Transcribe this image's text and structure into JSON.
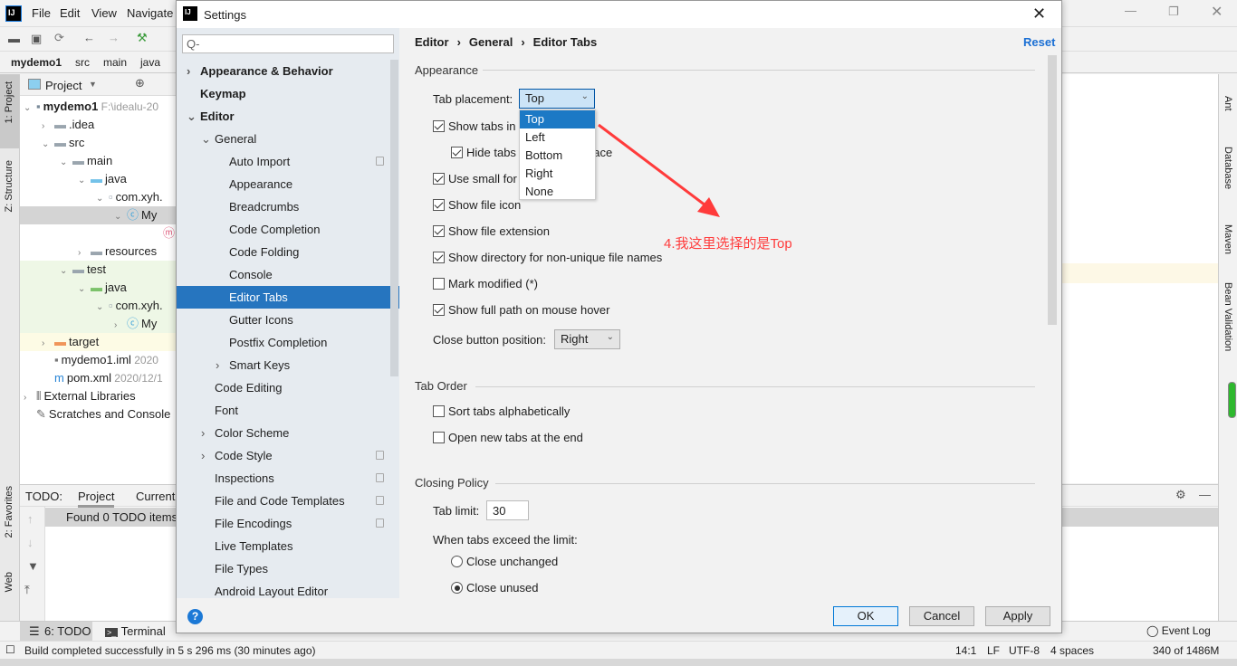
{
  "ide": {
    "menu": [
      "File",
      "Edit",
      "View",
      "Navigate"
    ],
    "breadcrumb": [
      "mydemo1",
      "src",
      "main",
      "java"
    ],
    "left_strip": [
      "1: Project",
      "Z: Structure",
      "2: Favorites",
      "Web"
    ],
    "right_strip": [
      "Ant",
      "Database",
      "Maven",
      "Bean Validation"
    ],
    "project_panel": {
      "title": "Project",
      "tree": [
        {
          "label": "mydemo1",
          "extra": "F:\\idealu-20",
          "bold": true
        },
        {
          "label": ".idea"
        },
        {
          "label": "src"
        },
        {
          "label": "main"
        },
        {
          "label": "java"
        },
        {
          "label": "com.xyh."
        },
        {
          "label": "My"
        },
        {
          "label": ""
        },
        {
          "label": "resources"
        },
        {
          "label": "test"
        },
        {
          "label": "java"
        },
        {
          "label": "com.xyh."
        },
        {
          "label": "My"
        },
        {
          "label": "target"
        },
        {
          "label": "mydemo1.iml",
          "extra": "2020"
        },
        {
          "label": "pom.xml",
          "extra": "2020/12/1"
        },
        {
          "label": "External Libraries"
        },
        {
          "label": "Scratches and Console"
        }
      ]
    },
    "todo": {
      "label": "TODO:",
      "tabs": [
        "Project",
        "Current"
      ],
      "found": "Found 0 TODO items"
    },
    "bottom_tabs": [
      "6: TODO",
      "Terminal"
    ],
    "event_log": "Event Log",
    "status": {
      "message": "Build completed successfully in 5 s 296 ms (30 minutes ago)",
      "position": "14:1",
      "line_sep": "LF",
      "encoding": "UTF-8",
      "indent": "4 spaces",
      "memory": "340 of 1486M"
    }
  },
  "dialog": {
    "title": "Settings",
    "search_placeholder": "Q-",
    "breadcrumb": [
      "Editor",
      "General",
      "Editor Tabs"
    ],
    "reset": "Reset",
    "nav": [
      {
        "label": "Appearance & Behavior",
        "level": 0,
        "bold": true,
        "chev": ">"
      },
      {
        "label": "Keymap",
        "level": 0,
        "bold": true
      },
      {
        "label": "Editor",
        "level": 0,
        "bold": true,
        "chev": "v"
      },
      {
        "label": "General",
        "level": 1,
        "chev": "v"
      },
      {
        "label": "Auto Import",
        "level": 2,
        "copy": true
      },
      {
        "label": "Appearance",
        "level": 2
      },
      {
        "label": "Breadcrumbs",
        "level": 2
      },
      {
        "label": "Code Completion",
        "level": 2
      },
      {
        "label": "Code Folding",
        "level": 2
      },
      {
        "label": "Console",
        "level": 2
      },
      {
        "label": "Editor Tabs",
        "level": 2,
        "selected": true
      },
      {
        "label": "Gutter Icons",
        "level": 2
      },
      {
        "label": "Postfix Completion",
        "level": 2
      },
      {
        "label": "Smart Keys",
        "level": 2,
        "chev": ">"
      },
      {
        "label": "Code Editing",
        "level": 1
      },
      {
        "label": "Font",
        "level": 1
      },
      {
        "label": "Color Scheme",
        "level": 1,
        "chev": ">"
      },
      {
        "label": "Code Style",
        "level": 1,
        "chev": ">",
        "copy": true
      },
      {
        "label": "Inspections",
        "level": 1,
        "copy": true
      },
      {
        "label": "File and Code Templates",
        "level": 1,
        "copy": true
      },
      {
        "label": "File Encodings",
        "level": 1,
        "copy": true
      },
      {
        "label": "Live Templates",
        "level": 1
      },
      {
        "label": "File Types",
        "level": 1
      },
      {
        "label": "Android Layout Editor",
        "level": 1
      }
    ],
    "appearance": {
      "title": "Appearance",
      "tab_placement_label": "Tab placement:",
      "tab_placement_value": "Top",
      "tab_placement_options": [
        "Top",
        "Left",
        "Bottom",
        "Right",
        "None"
      ],
      "options": [
        {
          "label": "Show tabs in",
          "checked": true,
          "indent": false
        },
        {
          "label": "Hide tabs",
          "suffix": "pace",
          "checked": true,
          "indent": true
        },
        {
          "label": "Use small for",
          "checked": true,
          "indent": false
        },
        {
          "label": "Show file icon",
          "checked": true,
          "indent": false
        },
        {
          "label": "Show file extension",
          "checked": true,
          "indent": false
        },
        {
          "label": "Show directory for non-unique file names",
          "checked": true,
          "indent": false
        },
        {
          "label": "Mark modified (*)",
          "checked": false,
          "indent": false
        },
        {
          "label": "Show full path on mouse hover",
          "checked": true,
          "indent": false
        }
      ],
      "close_button_label": "Close button position:",
      "close_button_value": "Right"
    },
    "tab_order": {
      "title": "Tab Order",
      "options": [
        {
          "label": "Sort tabs alphabetically",
          "checked": false
        },
        {
          "label": "Open new tabs at the end",
          "checked": false
        }
      ]
    },
    "closing_policy": {
      "title": "Closing Policy",
      "tab_limit_label": "Tab limit:",
      "tab_limit": "30",
      "exceed_label": "When tabs exceed the limit:",
      "radios": [
        {
          "label": "Close unchanged",
          "checked": false
        },
        {
          "label": "Close unused",
          "checked": true
        }
      ]
    },
    "buttons": {
      "ok": "OK",
      "cancel": "Cancel",
      "apply": "Apply"
    }
  },
  "annotation": {
    "text": "4.我这里选择的是Top",
    "color": "#ff3b3b"
  },
  "colors": {
    "selection": "#2675bf",
    "link": "#1a6fd4"
  }
}
